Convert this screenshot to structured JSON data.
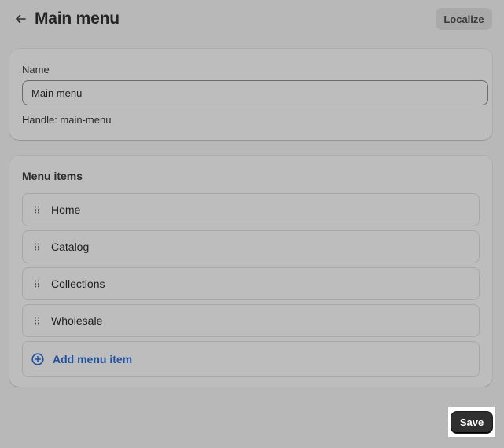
{
  "header": {
    "title": "Main menu",
    "back_icon": "arrow-left-icon",
    "localize_label": "Localize"
  },
  "name_card": {
    "label": "Name",
    "value": "Main menu",
    "handle": "Handle: main-menu"
  },
  "menu_card": {
    "title": "Menu items",
    "items": [
      {
        "label": "Home"
      },
      {
        "label": "Catalog"
      },
      {
        "label": "Collections"
      },
      {
        "label": "Wholesale"
      }
    ],
    "add_label": "Add menu item",
    "add_icon": "plus-circle-icon",
    "drag_icon": "drag-handle-icon"
  },
  "footer": {
    "save_label": "Save"
  },
  "colors": {
    "background": "#b8b8b8",
    "card": "#bdbdbd",
    "link": "#1e4fa0",
    "primary_button": "#2f2f2f"
  }
}
